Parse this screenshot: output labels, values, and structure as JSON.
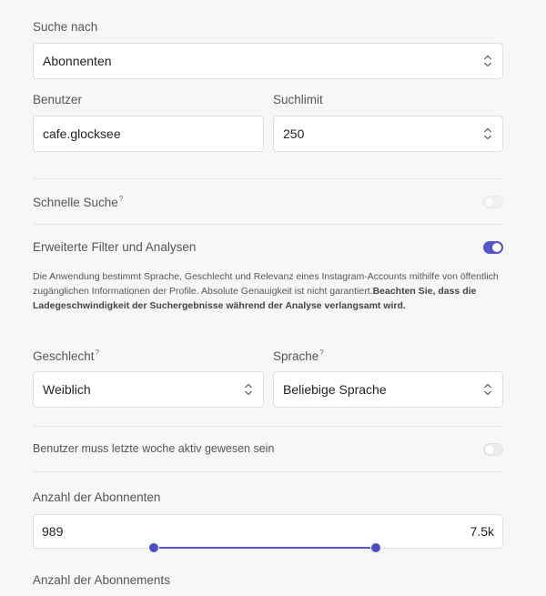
{
  "search_by": {
    "label": "Suche nach",
    "value": "Abonnenten"
  },
  "user": {
    "label": "Benutzer",
    "value": "cafe.glocksee"
  },
  "limit": {
    "label": "Suchlimit",
    "value": "250"
  },
  "quick_search": {
    "label": "Schnelle Suche",
    "hint": "?",
    "enabled": false
  },
  "advanced": {
    "label": "Erweiterte Filter und Analysen",
    "enabled": true,
    "description": "Die Anwendung bestimmt Sprache, Geschlecht und Relevanz eines Instagram-Accounts mithilfe von öffentlich zugänglichen Informationen der Profile. Absolute Genauigkeit ist nicht garantiert.",
    "warning": "Beachten Sie, dass die Ladegeschwindigkeit der Suchergebnisse während der Analyse verlangsamt wird."
  },
  "gender": {
    "label": "Geschlecht",
    "hint": "?",
    "value": "Weiblich"
  },
  "language": {
    "label": "Sprache",
    "hint": "?",
    "value": "Beliebige Sprache"
  },
  "active_last_week": {
    "label": "Benutzer muss letzte woche aktiv gewesen sein",
    "enabled": false
  },
  "followers_count": {
    "label": "Anzahl der Abonnenten",
    "min": "989",
    "max": "7.5k"
  },
  "following_count": {
    "label": "Anzahl der Abonnements"
  },
  "colors": {
    "accent": "#5556c9",
    "background": "#f7f7f7"
  }
}
